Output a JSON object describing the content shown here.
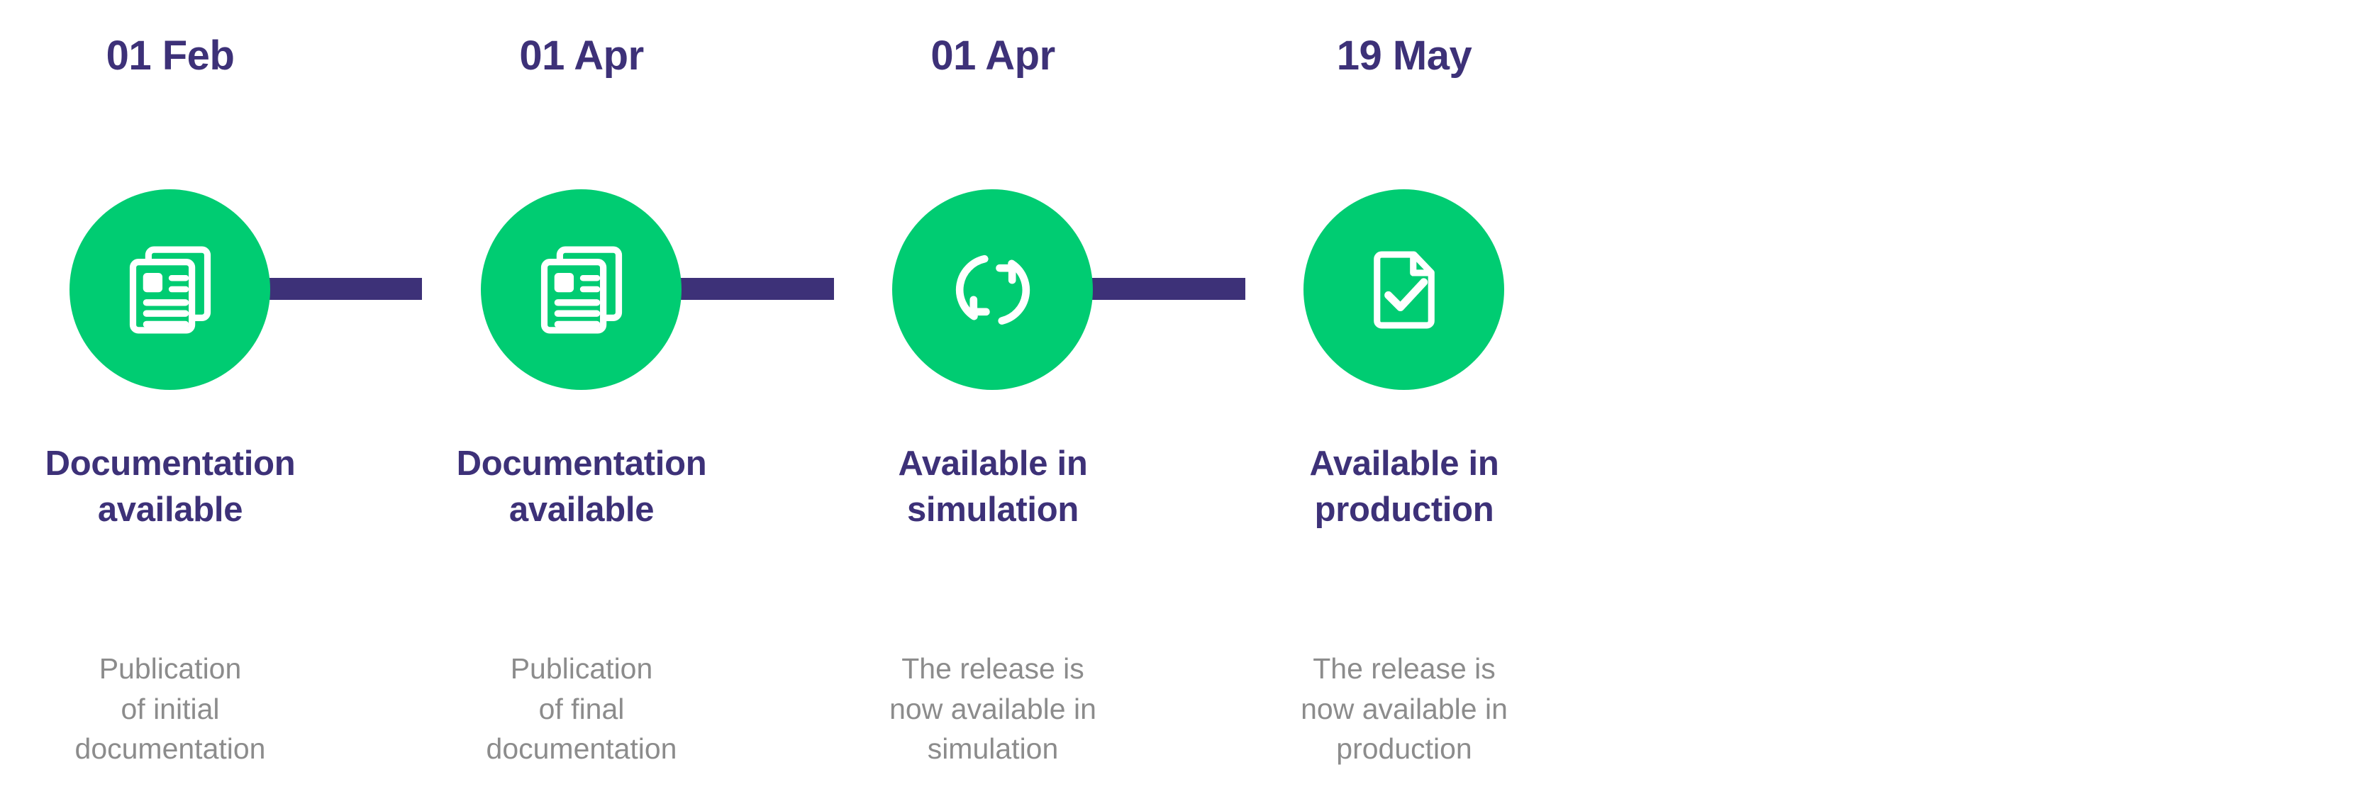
{
  "theme": {
    "background": "#ffffff",
    "accent_green": "#00cc72",
    "accent_purple": "#3d3178",
    "description_gray": "#8c8c8c"
  },
  "timeline": {
    "name": "release-timeline",
    "orientation": "horizontal",
    "milestones": [
      {
        "date": "01 Feb",
        "icon": "documents-stack-icon",
        "title": "Documentation available",
        "description": "Publication of initial documentation",
        "title_lines": [
          "Documentation",
          "available"
        ],
        "description_lines": [
          "Publication",
          "of initial",
          "documentation"
        ]
      },
      {
        "date": "01 Apr",
        "icon": "documents-stack-icon",
        "title": "Documentation available",
        "description": "Publication of final documentation",
        "title_lines": [
          "Documentation",
          "available"
        ],
        "description_lines": [
          "Publication",
          "of final",
          "documentation"
        ]
      },
      {
        "date": "01 Apr",
        "icon": "sync-refresh-icon",
        "title": "Available in simulation",
        "description": "The release is now available in simulation",
        "title_lines": [
          "Available in",
          "simulation"
        ],
        "description_lines": [
          "The release is",
          "now available in",
          "simulation"
        ]
      },
      {
        "date": "19 May",
        "icon": "document-check-icon",
        "title": "Available in production",
        "description": "The release is now available in production",
        "title_lines": [
          "Available in",
          "production"
        ],
        "description_lines": [
          "The release is",
          "now available in",
          "production"
        ]
      }
    ]
  }
}
